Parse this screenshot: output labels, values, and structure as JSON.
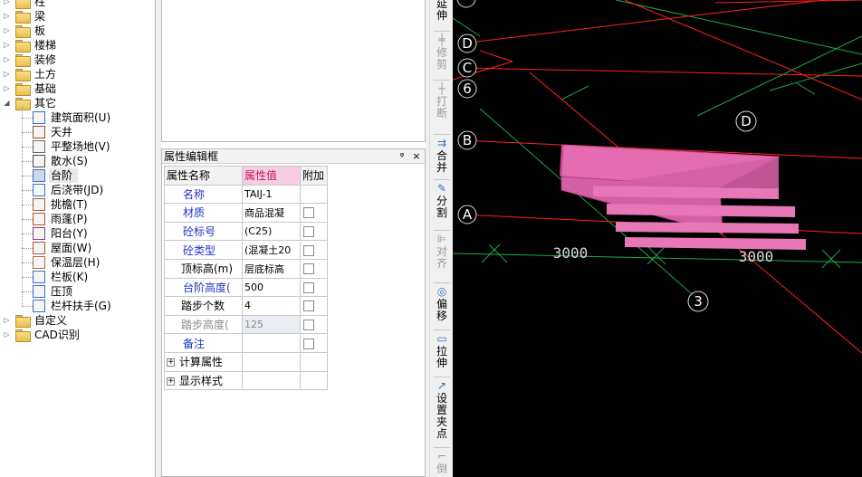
{
  "tree": {
    "folders_top": [
      "柱",
      "梁",
      "板",
      "楼梯",
      "装修",
      "土方",
      "基础",
      "其它"
    ],
    "other_children": [
      "建筑面积(U)",
      "天井",
      "平整场地(V)",
      "散水(S)",
      "台阶",
      "后浇带(JD)",
      "挑檐(T)",
      "雨蓬(P)",
      "阳台(Y)",
      "屋面(W)",
      "保温层(H)",
      "栏板(K)",
      "压顶",
      "栏杆扶手(G)"
    ],
    "folders_bottom": [
      "自定义",
      "CAD识别"
    ],
    "selected": "台阶"
  },
  "properties": {
    "panel_title": "属性编辑框",
    "pin_glyph": "ᵠ",
    "close_glyph": "×",
    "headers": {
      "name": "属性名称",
      "value": "属性值",
      "extra": "附加"
    },
    "rows": [
      {
        "name": "名称",
        "value": "TAIJ-1",
        "style": "blue",
        "checkbox": false
      },
      {
        "name": "材质",
        "value": "商品混凝",
        "style": "blue",
        "checkbox": true
      },
      {
        "name": "砼标号",
        "value": "(C25)",
        "style": "blue",
        "checkbox": true
      },
      {
        "name": "砼类型",
        "value": "(混凝土20",
        "style": "blue",
        "checkbox": true
      },
      {
        "name": "顶标高(m)",
        "value": "层底标高",
        "style": "normal",
        "checkbox": true
      },
      {
        "name": "台阶高度(",
        "value": "500",
        "style": "blue",
        "checkbox": true
      },
      {
        "name": "踏步个数",
        "value": "4",
        "style": "normal",
        "checkbox": true
      },
      {
        "name": "踏步高度(",
        "value": "125",
        "style": "gray",
        "checkbox": true
      },
      {
        "name": "备注",
        "value": "",
        "style": "blue",
        "checkbox": true
      }
    ],
    "groups": [
      "计算属性",
      "显示样式"
    ]
  },
  "toolbar": {
    "buttons": [
      {
        "label": "延伸",
        "icon": "extend-icon",
        "enabled": true
      },
      {
        "label": "修剪",
        "icon": "trim-icon",
        "enabled": false
      },
      {
        "label": "打断",
        "icon": "break-icon",
        "enabled": false
      },
      {
        "label": "合并",
        "icon": "merge-icon",
        "enabled": true
      },
      {
        "label": "分割",
        "icon": "split-icon",
        "enabled": true
      },
      {
        "label": "对齐",
        "icon": "align-icon",
        "enabled": false
      },
      {
        "label": "偏移",
        "icon": "offset-icon",
        "enabled": true
      },
      {
        "label": "拉伸",
        "icon": "stretch-icon",
        "enabled": true
      },
      {
        "label": "设置夹点",
        "icon": "grip-icon",
        "enabled": true
      },
      {
        "label": "倒",
        "icon": "chamfer-icon",
        "enabled": false
      }
    ]
  },
  "canvas": {
    "axis_labels": [
      "D",
      "C",
      "6",
      "B",
      "A",
      "D",
      "3"
    ],
    "dimensions": [
      "3000",
      "3000"
    ],
    "colors": {
      "background": "#000000",
      "axis_red": "#ff2020",
      "grid_green": "#1fa84a",
      "slab_pink": "#e56bb0"
    }
  }
}
